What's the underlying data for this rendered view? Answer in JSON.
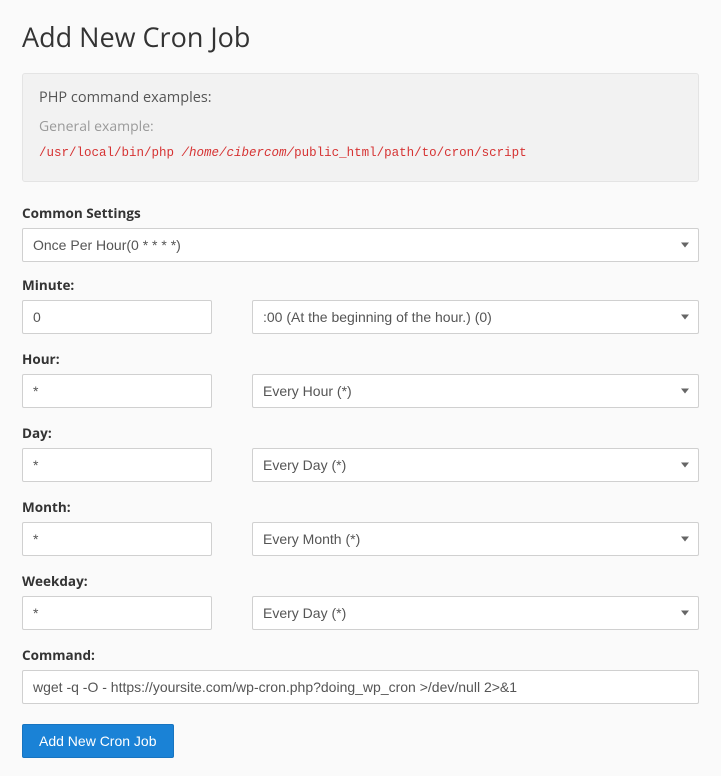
{
  "page_title": "Add New Cron Job",
  "example": {
    "title": "PHP command examples:",
    "subtitle": "General example:",
    "code_part1": "/usr/local/bin/php ",
    "code_part2_italic": "/home/cibercom/",
    "code_part3": "public_html/path/to/cron/script"
  },
  "common": {
    "label": "Common Settings",
    "selected": "Once Per Hour(0 * * * *)"
  },
  "fields": {
    "minute": {
      "label": "Minute:",
      "value": "0",
      "select": ":00 (At the beginning of the hour.) (0)"
    },
    "hour": {
      "label": "Hour:",
      "value": "*",
      "select": "Every Hour (*)"
    },
    "day": {
      "label": "Day:",
      "value": "*",
      "select": "Every Day (*)"
    },
    "month": {
      "label": "Month:",
      "value": "*",
      "select": "Every Month (*)"
    },
    "weekday": {
      "label": "Weekday:",
      "value": "*",
      "select": "Every Day (*)"
    }
  },
  "command": {
    "label": "Command:",
    "value": "wget -q -O - https://yoursite.com/wp-cron.php?doing_wp_cron >/dev/null 2>&1"
  },
  "submit_label": "Add New Cron Job"
}
